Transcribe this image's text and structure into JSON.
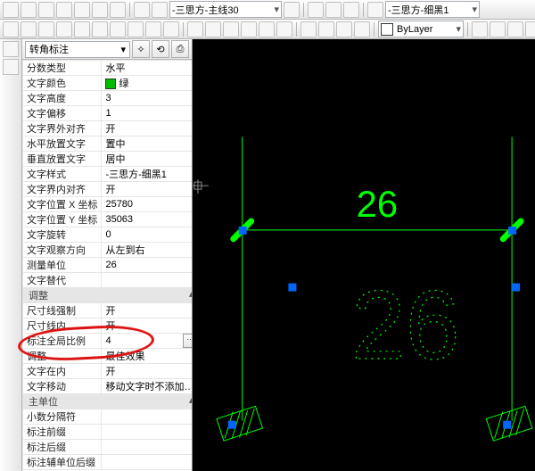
{
  "toolbar_top": {
    "linestyle_combo": "-三思方-主线30",
    "bylayer_combo": "ByLayer",
    "text_style_combo": "-三思方-细黑1"
  },
  "palette": {
    "selector": "转角标注",
    "rows": [
      {
        "k": "分数类型",
        "v": "水平"
      },
      {
        "k": "文字颜色",
        "v": "绿",
        "swatch": true
      },
      {
        "k": "文字高度",
        "v": "3"
      },
      {
        "k": "文字偏移",
        "v": "1"
      },
      {
        "k": "文字界外对齐",
        "v": "开"
      },
      {
        "k": "水平放置文字",
        "v": "置中"
      },
      {
        "k": "垂直放置文字",
        "v": "居中"
      },
      {
        "k": "文字样式",
        "v": "-三思方-细黑1"
      },
      {
        "k": "文字界内对齐",
        "v": "开"
      },
      {
        "k": "文字位置 X 坐标",
        "v": "25780"
      },
      {
        "k": "文字位置 Y 坐标",
        "v": "35063"
      },
      {
        "k": "文字旋转",
        "v": "0"
      },
      {
        "k": "文字观察方向",
        "v": "从左到右"
      },
      {
        "k": "测量单位",
        "v": "26"
      },
      {
        "k": "文字替代",
        "v": ""
      }
    ],
    "cat2": "调整",
    "rows2": [
      {
        "k": "尺寸线强制",
        "v": "开"
      },
      {
        "k": "尺寸线内",
        "v": "开"
      },
      {
        "k": "标注全局比例",
        "v": "4",
        "btn": true,
        "circle": true
      },
      {
        "k": "调整",
        "v": "最佳效果"
      },
      {
        "k": "文字在内",
        "v": "开"
      },
      {
        "k": "文字移动",
        "v": "移动文字时不添加…"
      }
    ],
    "cat3": "主单位",
    "rows3": [
      {
        "k": "小数分隔符",
        "v": ""
      },
      {
        "k": "标注前缀",
        "v": ""
      },
      {
        "k": "标注后缀",
        "v": ""
      },
      {
        "k": "标注辅单位后缀",
        "v": ""
      }
    ]
  },
  "canvas": {
    "dim_text": "26",
    "anno_text": "26"
  }
}
